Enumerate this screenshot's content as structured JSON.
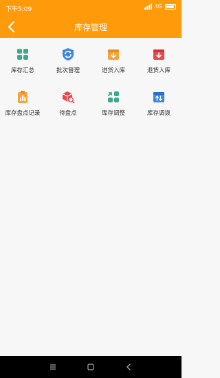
{
  "status_bar": {
    "time": "下午5:09",
    "network": "4G",
    "battery": ""
  },
  "nav_bar": {
    "title": "库存管理"
  },
  "tiles": [
    {
      "label": "库存汇总",
      "icon": "grid-squares-icon",
      "color": "#3da98b"
    },
    {
      "label": "批次管理",
      "icon": "shield-cycle-icon",
      "color": "#3a86e0"
    },
    {
      "label": "进货入库",
      "icon": "box-arrow-in-icon",
      "color": "#f3a43c"
    },
    {
      "label": "退货入库",
      "icon": "box-arrow-return-icon",
      "color": "#e9484a"
    },
    {
      "label": "库存盘点记录",
      "icon": "clipboard-chart-icon",
      "color": "#f3a43c"
    },
    {
      "label": "待盘点",
      "icon": "cube-search-icon",
      "color": "#e9484a"
    },
    {
      "label": "库存调整",
      "icon": "adjust-arrows-icon",
      "color": "#3da98b"
    },
    {
      "label": "库存调拨",
      "icon": "box-transfer-icon",
      "color": "#3a86e0"
    }
  ]
}
